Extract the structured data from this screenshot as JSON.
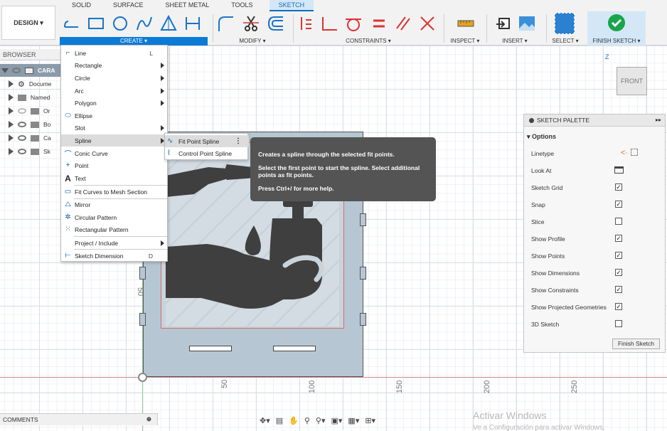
{
  "toolbar": {
    "design_label": "DESIGN",
    "tabs": [
      "SOLID",
      "SURFACE",
      "SHEET METAL",
      "TOOLS",
      "SKETCH"
    ],
    "groups": {
      "create": "CREATE",
      "modify": "MODIFY",
      "constraints": "CONSTRAINTS",
      "inspect": "INSPECT",
      "insert": "INSERT",
      "select": "SELECT",
      "finish": "FINISH SKETCH"
    },
    "accent": "#0b7bd6",
    "finish_color": "#19a54a"
  },
  "browser": {
    "title": "BROWSER",
    "items": [
      {
        "label": "CARA"
      },
      {
        "label": "Docume"
      },
      {
        "label": "Named"
      },
      {
        "label": "Or"
      },
      {
        "label": "Bo"
      },
      {
        "label": "Ca"
      },
      {
        "label": "Sk"
      }
    ]
  },
  "create_menu": {
    "items": [
      {
        "label": "Line",
        "shortcut": "L",
        "icon": "line-icon"
      },
      {
        "label": "Rectangle",
        "icon": "rectangle-icon"
      },
      {
        "label": "Circle",
        "icon": "circle-icon"
      },
      {
        "label": "Arc",
        "icon": "arc-icon"
      },
      {
        "label": "Polygon",
        "icon": "polygon-icon"
      },
      {
        "label": "Ellipse",
        "icon": "ellipse-icon"
      },
      {
        "label": "Slot",
        "icon": "slot-icon"
      },
      {
        "label": "Spline",
        "icon": "spline-icon"
      },
      {
        "label": "Conic Curve",
        "icon": "conic-curve-icon"
      },
      {
        "label": "Point",
        "icon": "point-icon"
      },
      {
        "label": "Text",
        "icon": "text-icon"
      },
      {
        "label": "Fit Curves to Mesh Section",
        "icon": "fit-curves-icon"
      },
      {
        "label": "Mirror",
        "icon": "mirror-icon"
      },
      {
        "label": "Circular Pattern",
        "icon": "circular-pattern-icon"
      },
      {
        "label": "Rectangular Pattern",
        "icon": "rectangular-pattern-icon"
      },
      {
        "label": "Project / Include",
        "icon": "project-icon"
      },
      {
        "label": "Sketch Dimension",
        "shortcut": "D",
        "icon": "sketch-dimension-icon"
      }
    ]
  },
  "spline_menu": {
    "items": [
      {
        "label": "Fit Point Spline"
      },
      {
        "label": "Control Point Spline"
      }
    ]
  },
  "tooltip": {
    "line1": "Creates a spline through the selected fit points.",
    "line2": "Select the first point to start the spline. Select additional points as fit points.",
    "line3": "Press Ctrl+/ for more help."
  },
  "palette": {
    "title": "SKETCH PALETTE",
    "options_label": "Options",
    "rows": [
      {
        "label": "Linetype",
        "type": "icons"
      },
      {
        "label": "Look At",
        "type": "icon"
      },
      {
        "label": "Sketch Grid",
        "checked": true
      },
      {
        "label": "Snap",
        "checked": true
      },
      {
        "label": "Slice",
        "checked": false
      },
      {
        "label": "Show Profile",
        "checked": true
      },
      {
        "label": "Show Points",
        "checked": true
      },
      {
        "label": "Show Dimensions",
        "checked": true
      },
      {
        "label": "Show Constraints",
        "checked": true
      },
      {
        "label": "Show Projected Geometries",
        "checked": true
      },
      {
        "label": "3D Sketch",
        "checked": false
      }
    ],
    "finish_label": "Finish Sketch"
  },
  "viewcube": {
    "face": "FRONT",
    "axis": "Z"
  },
  "rulers": {
    "labels": [
      "50",
      "100",
      "150",
      "200",
      "250"
    ],
    "side_label": "50"
  },
  "comments": {
    "label": "COMMENTS"
  },
  "watermark": {
    "line1": "Activar Windows",
    "line2": "Ve a Configuración para activar Windows."
  }
}
